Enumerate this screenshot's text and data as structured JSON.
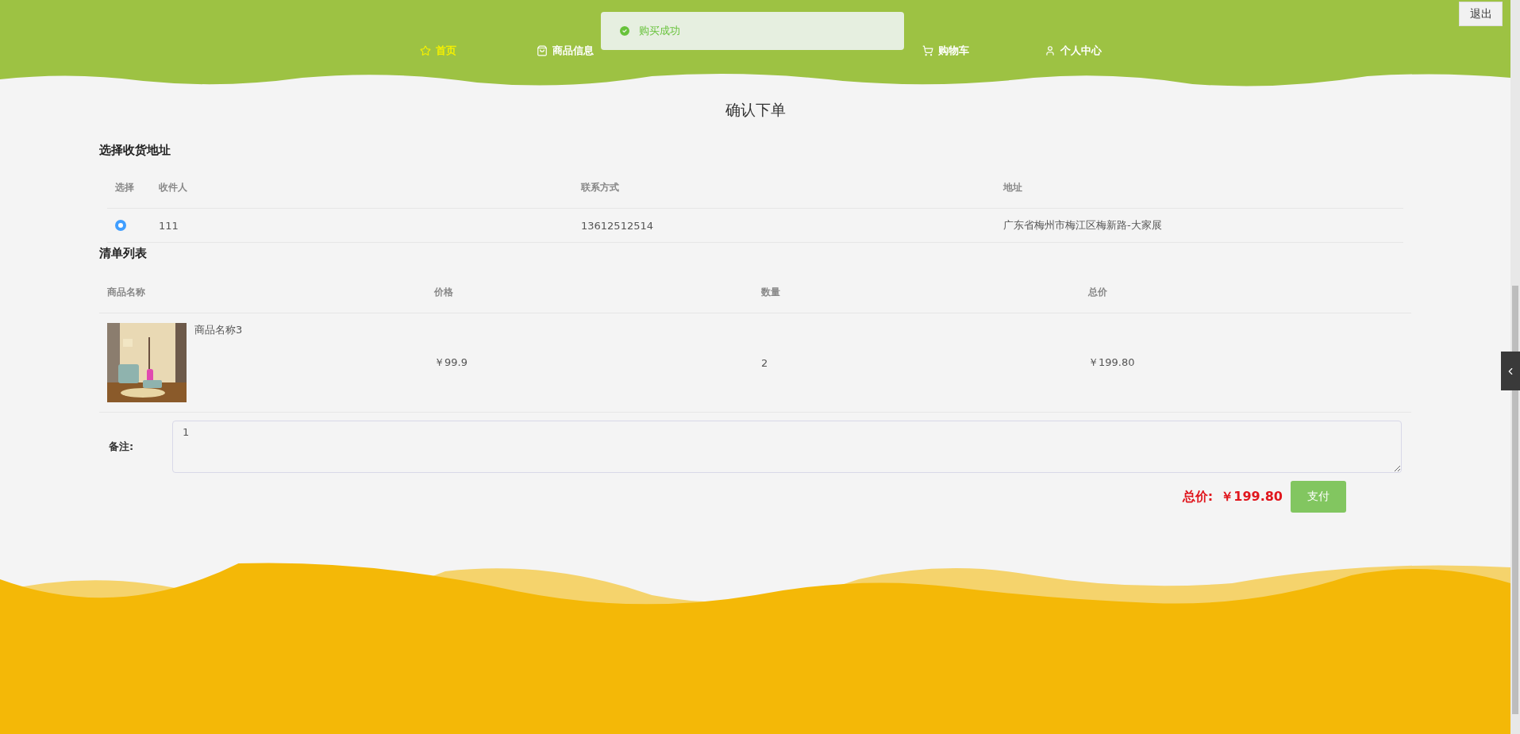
{
  "header": {
    "logout": "退出",
    "nav_start": [
      {
        "label": "首页",
        "selected": true
      },
      {
        "label": "商品信息",
        "selected": false
      }
    ],
    "nav_end": [
      {
        "label": "购物车",
        "selected": false
      },
      {
        "label": "个人中心",
        "selected": false
      }
    ]
  },
  "toast": {
    "message": "购买成功"
  },
  "page_title": "确认下单",
  "address_section": {
    "title": "选择收货地址",
    "columns": [
      "选择",
      "收件人",
      "联系方式",
      "地址"
    ],
    "rows": [
      {
        "selected": true,
        "name": "111",
        "phone": "13612512514",
        "address": "广东省梅州市梅江区梅新路-大家展"
      }
    ]
  },
  "order_section": {
    "title": "清单列表",
    "columns": [
      "商品名称",
      "价格",
      "数量",
      "总价"
    ],
    "rows": [
      {
        "name": "商品名称3",
        "price": "￥99.9",
        "quantity": "2",
        "total": "￥199.80"
      }
    ]
  },
  "note": {
    "label": "备注:",
    "value": "1"
  },
  "summary": {
    "label": "总价:",
    "amount": "￥199.80",
    "pay": "支付"
  }
}
